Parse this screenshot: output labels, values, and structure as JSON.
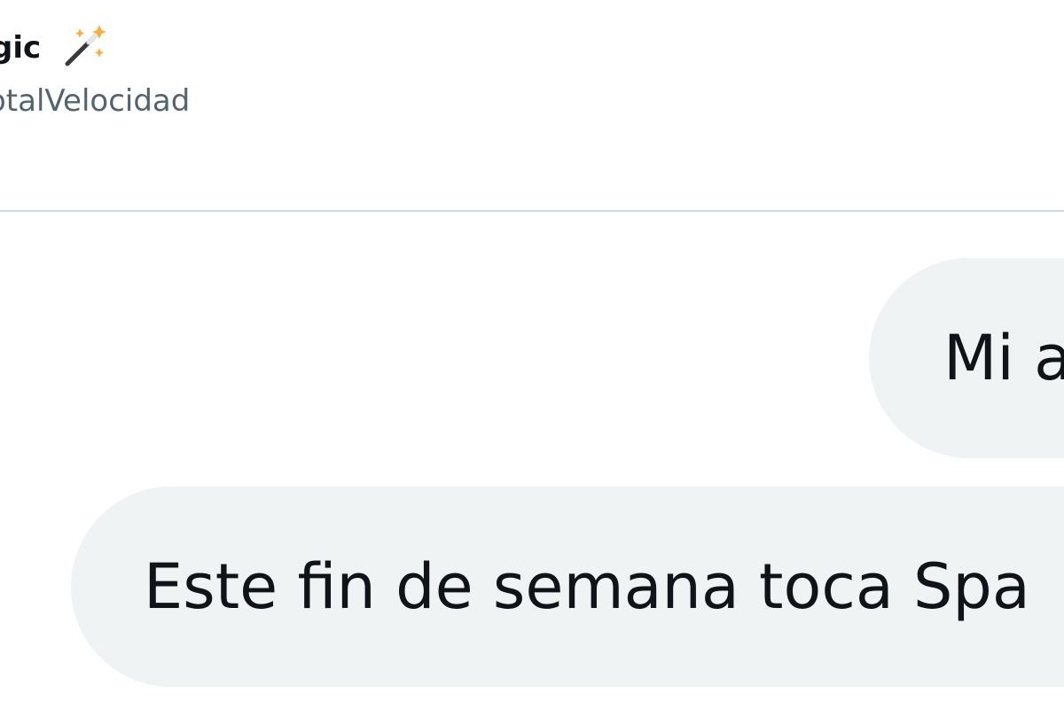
{
  "header": {
    "display_name": "gic",
    "handle": "otalVelocidad",
    "name_icon": "magic-wand-icon"
  },
  "conversation": {
    "messages": [
      {
        "text": "Mi a",
        "side": "right"
      },
      {
        "text": "Este fin de semana toca Spa",
        "side": "left"
      }
    ]
  },
  "colors": {
    "bubble_bg": "#eff3f4",
    "text_primary": "#0f1419",
    "text_secondary": "#536471",
    "divider": "#cfd9de",
    "sparkle": "#ffac33"
  }
}
